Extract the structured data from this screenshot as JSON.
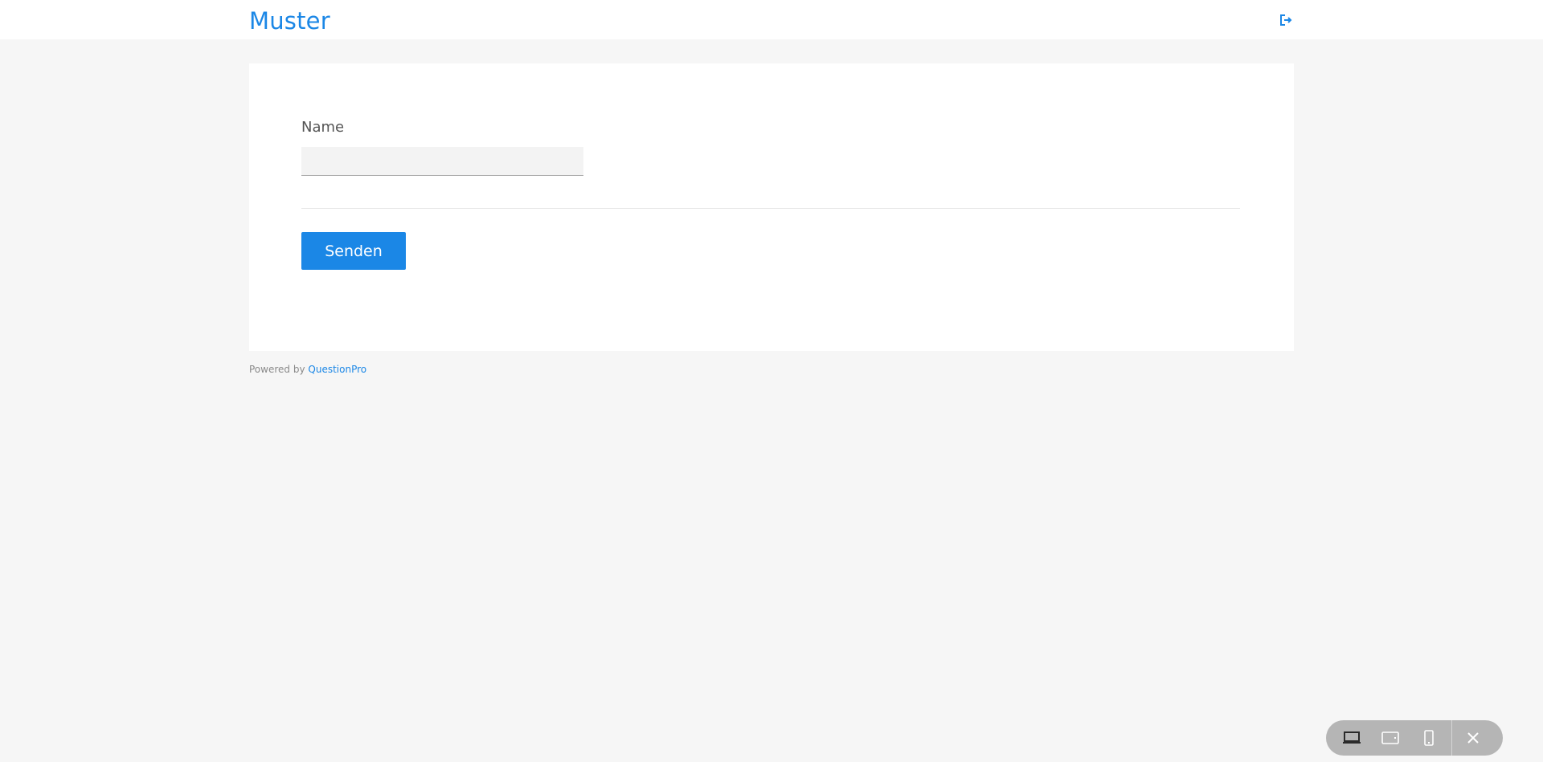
{
  "header": {
    "title": "Muster",
    "exit_icon": "exit-icon"
  },
  "progress": {
    "segments": 5,
    "color": "#1b87e6"
  },
  "form": {
    "name_label": "Name",
    "name_value": "",
    "submit_label": "Senden"
  },
  "footer": {
    "powered_by": "Powered by",
    "brand": "QuestionPro"
  },
  "device_toolbar": {
    "buttons": [
      "desktop-icon",
      "tablet-icon",
      "mobile-icon",
      "close-icon"
    ]
  },
  "colors": {
    "accent": "#1b87e6",
    "background": "#f6f6f6",
    "card": "#ffffff"
  }
}
